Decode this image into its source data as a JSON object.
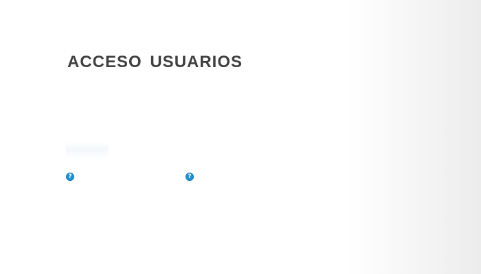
{
  "header": {
    "title": "ACCESO  USUARIOS"
  },
  "help_icons": [
    {
      "icon": "help-icon",
      "glyph": "?"
    },
    {
      "icon": "help-icon",
      "glyph": "?"
    }
  ],
  "colors": {
    "title": "#3f3f3f",
    "help_icon": "#1e8fd0"
  }
}
